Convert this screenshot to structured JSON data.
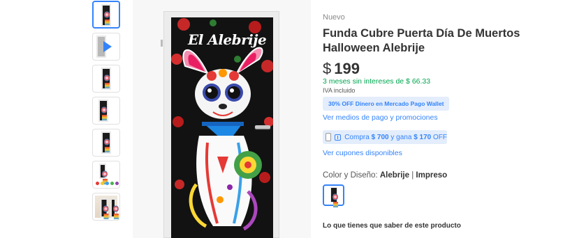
{
  "product": {
    "condition": "Nuevo",
    "title": "Funda Cubre Puerta Día De Muertos Halloween Alebrije",
    "price_currency": "$",
    "price_value": "199",
    "installments": "3 meses sin intereses de $ 66.33",
    "tax_note": "IVA incluido",
    "promo_badge": "30% OFF Dinero en Mercado Pago Wallet",
    "payment_link": "Ver medios de pago y promociones",
    "coupon": {
      "prefix": "Compra",
      "buy_amount": "$ 700",
      "middle": "y gana",
      "win_amount": "$ 170",
      "suffix": "OFF"
    },
    "coupons_link": "Ver cupones disponibles",
    "variant_label": "Color y Diseño:",
    "variant_value": "Alebrije",
    "variant_separator": "|",
    "variant_finish": "Impreso",
    "section_title": "Lo que tienes que saber de este producto"
  },
  "image": {
    "door_title": "El Alebrije"
  },
  "thumbnails": [
    {
      "kind": "door",
      "selected": true
    },
    {
      "kind": "video",
      "icon": "play-icon"
    },
    {
      "kind": "door"
    },
    {
      "kind": "door-dark"
    },
    {
      "kind": "door"
    },
    {
      "kind": "info"
    },
    {
      "kind": "room"
    }
  ],
  "colors": {
    "accent": "#3483fa",
    "green": "#00a650",
    "badge_bg": "#e3edfb"
  }
}
